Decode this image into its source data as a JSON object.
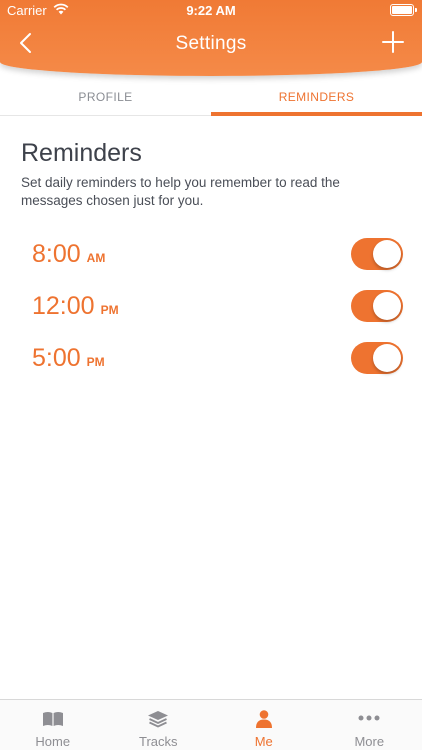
{
  "status_bar": {
    "carrier": "Carrier",
    "time": "9:22 AM"
  },
  "nav": {
    "title": "Settings"
  },
  "tabs": [
    {
      "label": "PROFILE",
      "active": false
    },
    {
      "label": "REMINDERS",
      "active": true
    }
  ],
  "reminders": {
    "title": "Reminders",
    "description": "Set daily reminders to help you remember to read the messages chosen just for you.",
    "items": [
      {
        "time": "8:00",
        "period": "AM",
        "enabled": true
      },
      {
        "time": "12:00",
        "period": "PM",
        "enabled": true
      },
      {
        "time": "5:00",
        "period": "PM",
        "enabled": true
      }
    ]
  },
  "tabbar": [
    {
      "label": "Home",
      "icon": "book-icon",
      "active": false
    },
    {
      "label": "Tracks",
      "icon": "layers-icon",
      "active": false
    },
    {
      "label": "Me",
      "icon": "person-icon",
      "active": true
    },
    {
      "label": "More",
      "icon": "more-dots-icon",
      "active": false
    }
  ],
  "colors": {
    "accent": "#ee7330",
    "header": "#f27d3a",
    "text": "#3e424b",
    "inactive": "#8e8e93"
  }
}
